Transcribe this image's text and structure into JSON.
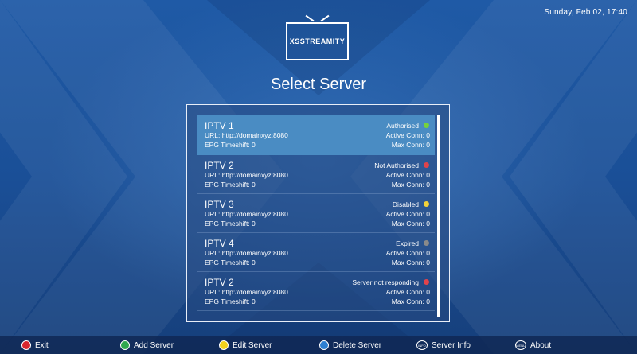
{
  "header": {
    "datetime": "Sunday, Feb 02, 17:40",
    "logo_text": "X̶S STREAMITY",
    "title": "Select Server"
  },
  "servers": [
    {
      "name": "IPTV 1",
      "url": "URL: http://domainxyz:8080",
      "epg": "EPG Timeshift: 0",
      "status": "Authorised",
      "status_color": "#76d23c",
      "active": "Active Conn:  0",
      "max": "Max Conn:  0",
      "selected": true
    },
    {
      "name": "IPTV 2",
      "url": "URL: http://domainxyz:8080",
      "epg": "EPG Timeshift: 0",
      "status": "Not Authorised",
      "status_color": "#e0434b",
      "active": "Active Conn:  0",
      "max": "Max Conn:  0",
      "selected": false
    },
    {
      "name": "IPTV 3",
      "url": "URL: http://domainxyz:8080",
      "epg": "EPG Timeshift: 0",
      "status": "Disabled",
      "status_color": "#f2d23a",
      "active": "Active Conn:  0",
      "max": "Max Conn:  0",
      "selected": false
    },
    {
      "name": "IPTV 4",
      "url": "URL: http://domainxyz:8080",
      "epg": "EPG Timeshift: 0",
      "status": "Expired",
      "status_color": "#8a8a8a",
      "active": "Active Conn:  0",
      "max": "Max Conn:  0",
      "selected": false
    },
    {
      "name": "IPTV 2",
      "url": "URL: http://domainxyz:8080",
      "epg": "EPG Timeshift: 0",
      "status": "Server not responding",
      "status_color": "#e0434b",
      "active": "Active Conn:  0",
      "max": "Max Conn:  0",
      "selected": false
    }
  ],
  "footer": {
    "exit": {
      "label": "Exit",
      "color": "#d7262e"
    },
    "add": {
      "label": "Add Server",
      "color": "#2fa84f"
    },
    "edit": {
      "label": "Edit Server",
      "color": "#f2d21b"
    },
    "delete": {
      "label": "Delete Server",
      "color": "#2c7fd2"
    },
    "info": {
      "label": "Server Info",
      "tag": "INFO"
    },
    "about": {
      "label": "About",
      "tag": "MENU"
    }
  }
}
